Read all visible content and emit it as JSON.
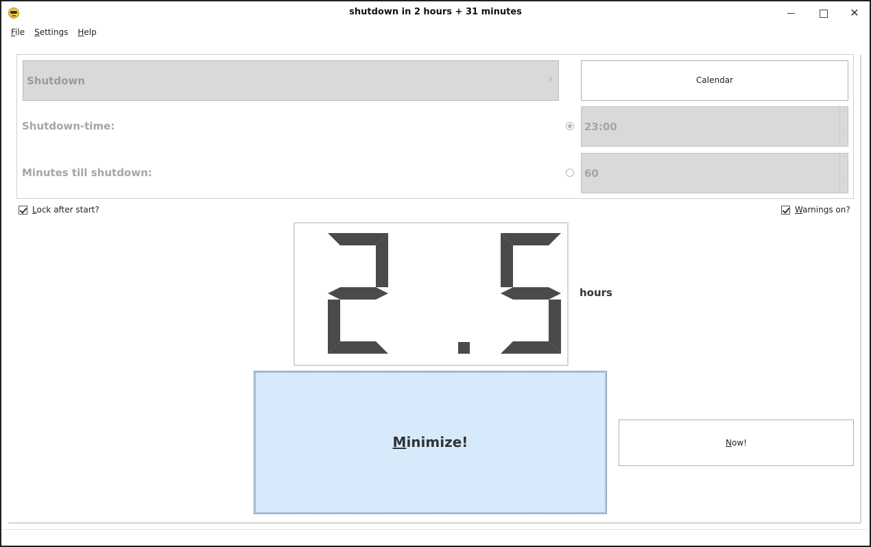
{
  "window": {
    "title": "shutdown in 2 hours + 31 minutes",
    "icon": "smiley-sunglasses-icon",
    "controls": [
      "minimize-icon",
      "maximize-icon",
      "close-icon"
    ]
  },
  "menubar": {
    "file": {
      "underline": "F",
      "rest": "ile"
    },
    "settings": {
      "underline": "S",
      "rest": "ettings"
    },
    "help": {
      "underline": "H",
      "rest": "elp"
    }
  },
  "action": {
    "selected": "Shutdown"
  },
  "calendar_button": "Calendar",
  "shutdown_time": {
    "label": "Shutdown-time:",
    "value": "23:00",
    "selected": true
  },
  "minutes_till": {
    "label": "Minutes till shutdown:",
    "value": "60",
    "selected": false
  },
  "lock_after_start": {
    "underline": "L",
    "rest": "ock after start?",
    "checked": true
  },
  "warnings_on": {
    "underline": "W",
    "rest": "arnings on?",
    "checked": true
  },
  "display": {
    "value": "2.5",
    "unit": "hours",
    "segment_color": "#4a4a4a"
  },
  "minimize_button": {
    "underline": "M",
    "rest": "inimize!"
  },
  "now_button": {
    "underline": "N",
    "rest": "ow!"
  },
  "colors": {
    "accent_button": "#d6eafc",
    "disabled_field": "#d9d9d9",
    "disabled_text": "#a5a5a5"
  }
}
